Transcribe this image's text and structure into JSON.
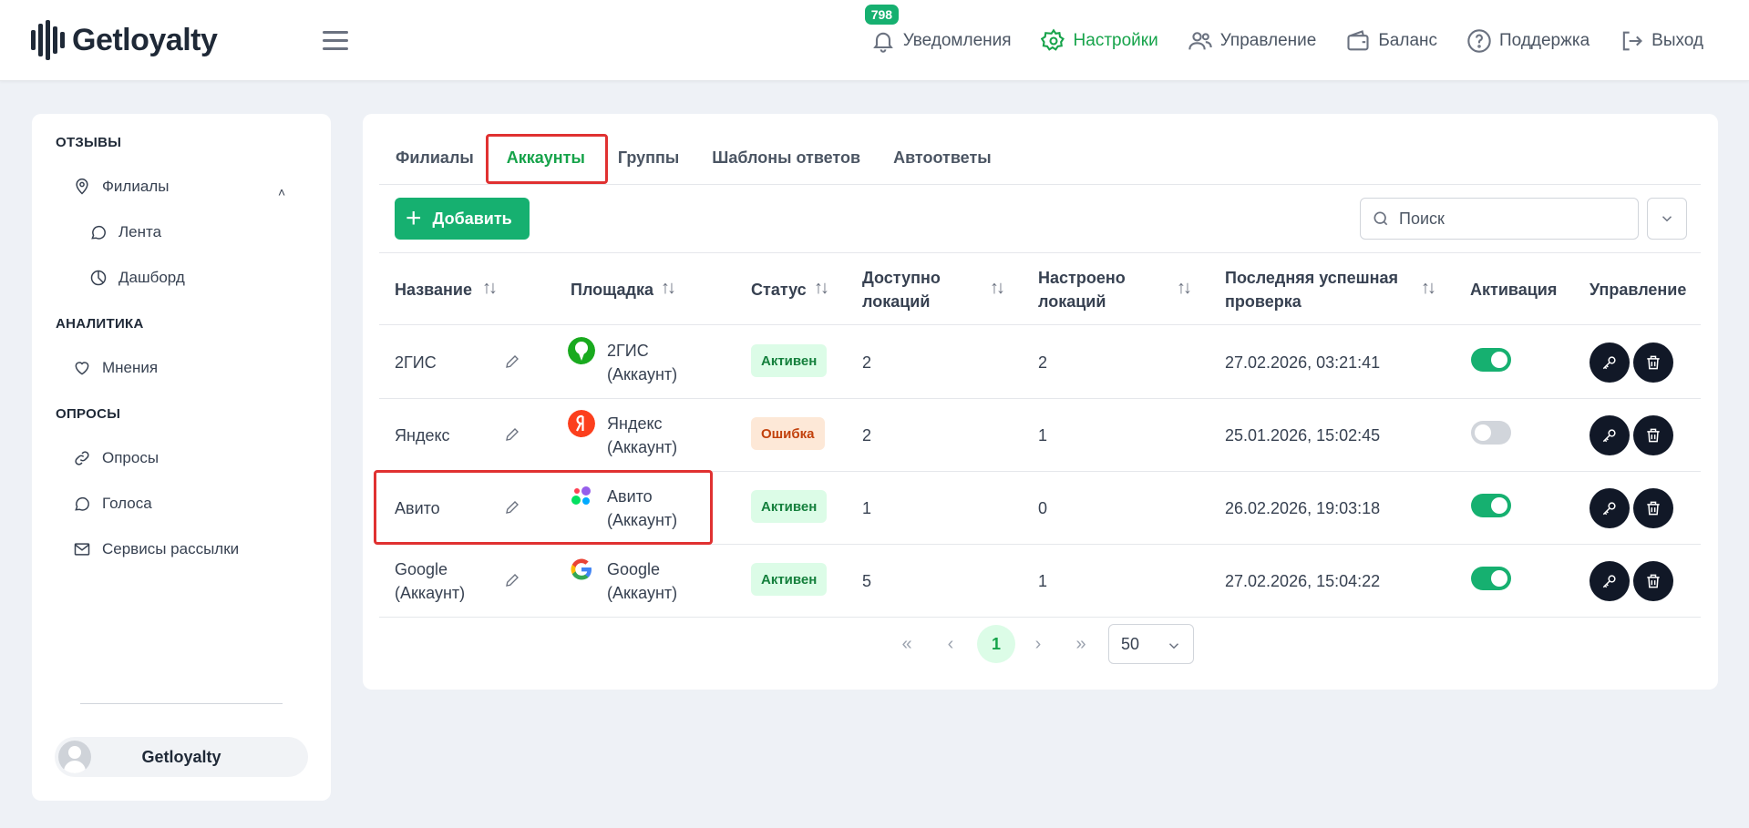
{
  "header": {
    "logo_text": "Getloyalty",
    "notifications_count": "798",
    "nav": [
      {
        "label": "Уведомления",
        "icon": "bell-icon"
      },
      {
        "label": "Настройки",
        "icon": "gear-icon",
        "active": true
      },
      {
        "label": "Управление",
        "icon": "users-icon"
      },
      {
        "label": "Баланс",
        "icon": "wallet-icon"
      },
      {
        "label": "Поддержка",
        "icon": "question-icon"
      },
      {
        "label": "Выход",
        "icon": "logout-icon"
      }
    ]
  },
  "sidebar": {
    "sections": [
      {
        "title": "ОТЗЫВЫ"
      },
      {
        "title": "АНАЛИТИКА"
      },
      {
        "title": "ОПРОСЫ"
      }
    ],
    "items": [
      {
        "label": "Филиалы",
        "icon": "map-pin-icon"
      },
      {
        "label": "Лента",
        "icon": "chat-icon"
      },
      {
        "label": "Дашборд",
        "icon": "dashboard-icon"
      },
      {
        "label": "Мнения",
        "icon": "heart-icon"
      },
      {
        "label": "Опросы",
        "icon": "link-icon"
      },
      {
        "label": "Голоса",
        "icon": "chat-icon"
      },
      {
        "label": "Сервисы рассылки",
        "icon": "mail-icon"
      }
    ],
    "user_name": "Getloyalty"
  },
  "tabs": [
    "Филиалы",
    "Аккаунты",
    "Группы",
    "Шаблоны ответов",
    "Автоответы"
  ],
  "active_tab": "Аккаунты",
  "toolbar": {
    "add_label": "Добавить",
    "search_placeholder": "Поиск"
  },
  "table": {
    "headers": {
      "name": "Название",
      "platform": "Площадка",
      "status": "Статус",
      "available_1": "Доступно",
      "available_2": "локаций",
      "configured_1": "Настроено",
      "configured_2": "локаций",
      "last_check_1": "Последняя успешная",
      "last_check_2": "проверка",
      "activation": "Активация",
      "manage": "Управление"
    },
    "rows": [
      {
        "name_1": "2ГИС",
        "name_2": "",
        "platform_1": "2ГИС",
        "platform_2": "(Аккаунт)",
        "platform_icon": "2gis-icon",
        "status": "Активен",
        "status_kind": "ok",
        "available": "2",
        "configured": "2",
        "last_check": "27.02.2026, 03:21:41",
        "active": true
      },
      {
        "name_1": "Яндекс",
        "name_2": "",
        "platform_1": "Яндекс",
        "platform_2": "(Аккаунт)",
        "platform_icon": "yandex-icon",
        "status": "Ошибка",
        "status_kind": "err",
        "available": "2",
        "configured": "1",
        "last_check": "25.01.2026, 15:02:45",
        "active": false
      },
      {
        "name_1": "Авито",
        "name_2": "",
        "platform_1": "Авито",
        "platform_2": "(Аккаунт)",
        "platform_icon": "avito-icon",
        "status": "Активен",
        "status_kind": "ok",
        "available": "1",
        "configured": "0",
        "last_check": "26.02.2026, 19:03:18",
        "active": true
      },
      {
        "name_1": "Google",
        "name_2": "(Аккаунт)",
        "platform_1": "Google",
        "platform_2": "(Аккаунт)",
        "platform_icon": "google-icon",
        "status": "Активен",
        "status_kind": "ok",
        "available": "5",
        "configured": "1",
        "last_check": "27.02.2026, 15:04:22",
        "active": true
      }
    ]
  },
  "pagination": {
    "first": "«",
    "prev": "‹",
    "current": "1",
    "next": "›",
    "last": "»",
    "per_page": "50"
  },
  "colors": {
    "accent": "#16b070",
    "highlight": "#e03131"
  }
}
